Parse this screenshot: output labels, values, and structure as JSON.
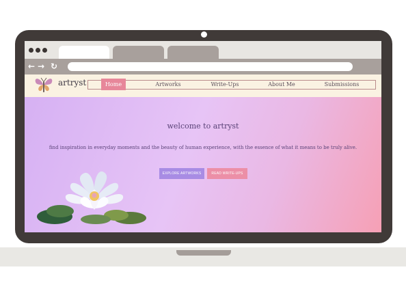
{
  "browser": {
    "back_icon": "back-arrow-icon",
    "forward_icon": "forward-arrow-icon",
    "reload_icon": "reload-icon",
    "back_glyph": "←",
    "forward_glyph": "→",
    "reload_glyph": "↻"
  },
  "site": {
    "logo_text": "artryst",
    "logo_icon": "butterfly-icon",
    "nav": [
      "Home",
      "Artworks",
      "Write-Ups",
      "About Me",
      "Submissions"
    ],
    "active_nav": "Home"
  },
  "hero": {
    "title": "welcome to artryst",
    "subtitle": "find inspiration in everyday moments and the beauty of human experience, with the essence of what it means to be truly alive.",
    "explore_button": "EXPLORE ARTWORKS",
    "read_button": "READ WRITE-UPS",
    "illustration_icon": "lotus-flower-icon"
  },
  "colors": {
    "bezel": "#403a38",
    "nav_bg": "#faf2e2",
    "active_nav": "#e7879a",
    "explore_button": "#a88ce4",
    "read_button": "#ec8fa7"
  }
}
